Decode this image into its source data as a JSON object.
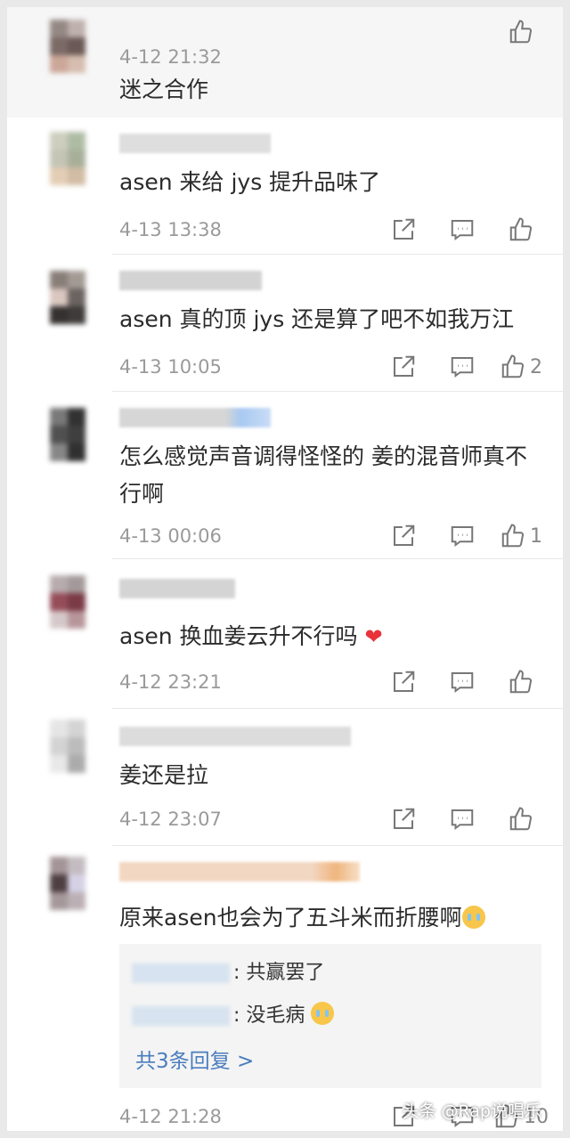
{
  "comments": [
    {
      "time": "4-12 21:32",
      "text": "迷之合作",
      "likes": "",
      "extra": ""
    },
    {
      "time": "4-13 13:38",
      "text": "asen 来给 jys 提升品味了",
      "likes": "",
      "extra": ""
    },
    {
      "time": "4-13 10:05",
      "text": "asen 真的顶 jys 还是算了吧不如我万江",
      "likes": "2",
      "extra": ""
    },
    {
      "time": "4-13 00:06",
      "text": "怎么感觉声音调得怪怪的 姜的混音师真不行啊",
      "likes": "1",
      "extra": ""
    },
    {
      "time": "4-12 23:21",
      "text": "asen 换血姜云升不行吗",
      "likes": "",
      "extra": "❤"
    },
    {
      "time": "4-12 23:07",
      "text": "姜还是拉",
      "likes": "",
      "extra": ""
    },
    {
      "time": "4-12 21:28",
      "text": "原来asen也会为了五斗米而折腰啊",
      "likes": "10",
      "extra": ""
    }
  ],
  "replies": [
    {
      "text": ": 共赢罢了"
    },
    {
      "text": ": 没毛病"
    }
  ],
  "reply_more": "共3条回复 >",
  "watermark": "头条 @Rap说唱乐"
}
